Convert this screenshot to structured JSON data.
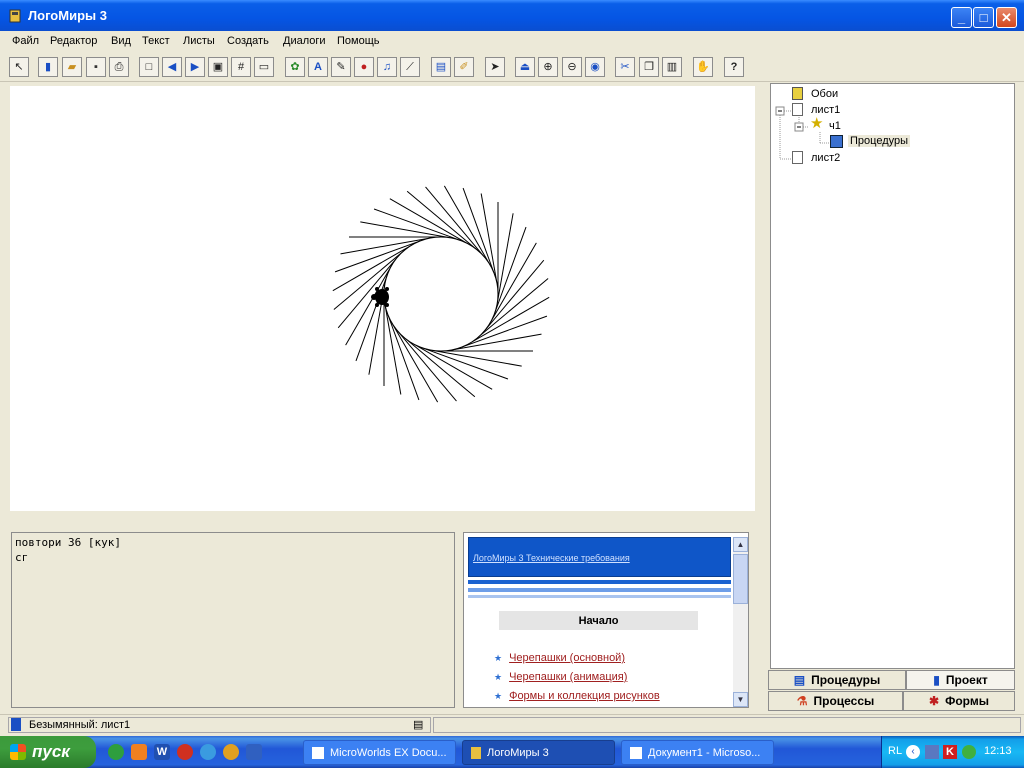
{
  "window": {
    "title": "ЛогоМиры 3"
  },
  "menu": [
    "Файл",
    "Редактор",
    "Вид",
    "Текст",
    "Листы",
    "Создать",
    "Диалоги",
    "Помощь"
  ],
  "command_center": {
    "lines": [
      "повтори 36 [кук]",
      "сг"
    ]
  },
  "help": {
    "header": "ЛогоМиры 3 Технические требования",
    "start_label": "Начало",
    "links": [
      "Черепашки (основной)",
      "Черепашки (анимация)",
      "Формы и коллекция рисунков"
    ]
  },
  "tree": {
    "items": [
      {
        "label": "Обои"
      },
      {
        "label": "лист1"
      },
      {
        "label": "ч1"
      },
      {
        "label": "Процедуры"
      },
      {
        "label": "лист2"
      }
    ]
  },
  "tabs": {
    "procedures": "Процедуры",
    "project": "Проект",
    "processes": "Процессы",
    "shapes": "Формы"
  },
  "status": {
    "text": "Безымянный: лист1"
  },
  "taskbar": {
    "start_label": "пуск",
    "tasks": [
      "MicroWorlds EX Docu...",
      "ЛогоМиры 3",
      "Документ1 - Microso..."
    ],
    "tray_lang": "RL",
    "clock": "12:13"
  },
  "colors": {
    "title_blue": "#0555E4",
    "taskbar_blue": "#245EDC",
    "start_green": "#3D9D3D",
    "link_red": "#A02020"
  },
  "drawing": {
    "rays": 36
  }
}
